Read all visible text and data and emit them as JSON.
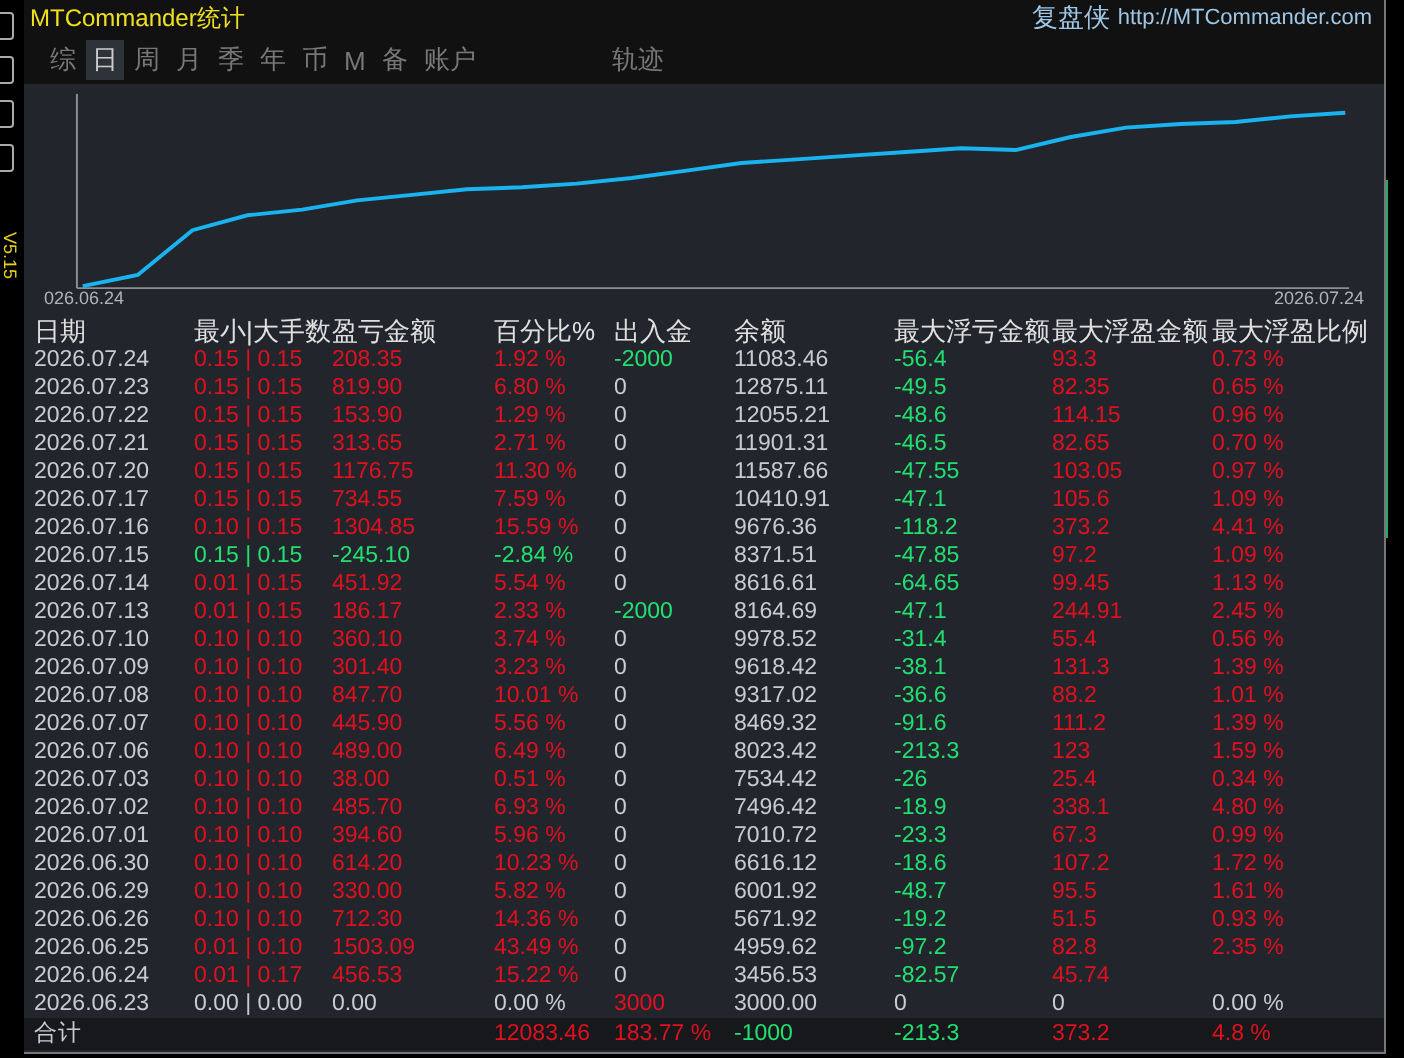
{
  "window": {
    "title": "MTCommander统计",
    "brand": "复盘侠",
    "url": "http://MTCommander.com"
  },
  "sidebar": {
    "version": "V5.15"
  },
  "tabs": [
    {
      "label": "综",
      "selected": false
    },
    {
      "label": "日",
      "selected": true
    },
    {
      "label": "周",
      "selected": false
    },
    {
      "label": "月",
      "selected": false
    },
    {
      "label": "季",
      "selected": false
    },
    {
      "label": "年",
      "selected": false
    },
    {
      "label": "币",
      "selected": false
    },
    {
      "label": "M",
      "selected": false
    },
    {
      "label": "备",
      "selected": false
    },
    {
      "label": "账户",
      "selected": false
    },
    {
      "label": "轨迹",
      "selected": false
    }
  ],
  "chart": {
    "x_start": "026.06.24",
    "x_end": "2026.07.24"
  },
  "table": {
    "columns": [
      "日期",
      "最小|大手数",
      "盈亏金额",
      "百分比%",
      "出入金",
      "余额",
      "最大浮亏金额",
      "最大浮盈金额",
      "最大浮盈比例"
    ],
    "rows": [
      {
        "kind": "profit",
        "withdrawal": true,
        "cells": [
          "2026.07.24",
          "0.15 | 0.15",
          "208.35",
          "1.92 %",
          "-2000",
          "11083.46",
          "-56.4",
          "93.3",
          "0.73 %"
        ]
      },
      {
        "kind": "profit",
        "withdrawal": false,
        "deposit": false,
        "cells": [
          "2026.07.23",
          "0.15 | 0.15",
          "819.90",
          "6.80 %",
          "0",
          "12875.11",
          "-49.5",
          "82.35",
          "0.65 %"
        ]
      },
      {
        "kind": "profit",
        "withdrawal": false,
        "deposit": false,
        "cells": [
          "2026.07.22",
          "0.15 | 0.15",
          "153.90",
          "1.29 %",
          "0",
          "12055.21",
          "-48.6",
          "114.15",
          "0.96 %"
        ]
      },
      {
        "kind": "profit",
        "withdrawal": false,
        "deposit": false,
        "cells": [
          "2026.07.21",
          "0.15 | 0.15",
          "313.65",
          "2.71 %",
          "0",
          "11901.31",
          "-46.5",
          "82.65",
          "0.70 %"
        ]
      },
      {
        "kind": "profit",
        "withdrawal": false,
        "deposit": false,
        "cells": [
          "2026.07.20",
          "0.15 | 0.15",
          "1176.75",
          "11.30 %",
          "0",
          "11587.66",
          "-47.55",
          "103.05",
          "0.97 %"
        ]
      },
      {
        "kind": "profit",
        "withdrawal": false,
        "deposit": false,
        "cells": [
          "2026.07.17",
          "0.15 | 0.15",
          "734.55",
          "7.59 %",
          "0",
          "10410.91",
          "-47.1",
          "105.6",
          "1.09 %"
        ]
      },
      {
        "kind": "profit",
        "withdrawal": false,
        "deposit": false,
        "cells": [
          "2026.07.16",
          "0.10 | 0.15",
          "1304.85",
          "15.59 %",
          "0",
          "9676.36",
          "-118.2",
          "373.2",
          "4.41 %"
        ]
      },
      {
        "kind": "loss",
        "withdrawal": false,
        "deposit": false,
        "cells": [
          "2026.07.15",
          "0.15 | 0.15",
          "-245.10",
          "-2.84 %",
          "0",
          "8371.51",
          "-47.85",
          "97.2",
          "1.09 %"
        ]
      },
      {
        "kind": "profit",
        "withdrawal": false,
        "deposit": false,
        "cells": [
          "2026.07.14",
          "0.01 | 0.15",
          "451.92",
          "5.54 %",
          "0",
          "8616.61",
          "-64.65",
          "99.45",
          "1.13 %"
        ]
      },
      {
        "kind": "profit",
        "withdrawal": true,
        "cells": [
          "2026.07.13",
          "0.01 | 0.15",
          "186.17",
          "2.33 %",
          "-2000",
          "8164.69",
          "-47.1",
          "244.91",
          "2.45 %"
        ]
      },
      {
        "kind": "profit",
        "withdrawal": false,
        "deposit": false,
        "cells": [
          "2026.07.10",
          "0.10 | 0.10",
          "360.10",
          "3.74 %",
          "0",
          "9978.52",
          "-31.4",
          "55.4",
          "0.56 %"
        ]
      },
      {
        "kind": "profit",
        "withdrawal": false,
        "deposit": false,
        "cells": [
          "2026.07.09",
          "0.10 | 0.10",
          "301.40",
          "3.23 %",
          "0",
          "9618.42",
          "-38.1",
          "131.3",
          "1.39 %"
        ]
      },
      {
        "kind": "profit",
        "withdrawal": false,
        "deposit": false,
        "cells": [
          "2026.07.08",
          "0.10 | 0.10",
          "847.70",
          "10.01 %",
          "0",
          "9317.02",
          "-36.6",
          "88.2",
          "1.01 %"
        ]
      },
      {
        "kind": "profit",
        "withdrawal": false,
        "deposit": false,
        "cells": [
          "2026.07.07",
          "0.10 | 0.10",
          "445.90",
          "5.56 %",
          "0",
          "8469.32",
          "-91.6",
          "111.2",
          "1.39 %"
        ]
      },
      {
        "kind": "profit",
        "withdrawal": false,
        "deposit": false,
        "cells": [
          "2026.07.06",
          "0.10 | 0.10",
          "489.00",
          "6.49 %",
          "0",
          "8023.42",
          "-213.3",
          "123",
          "1.59 %"
        ]
      },
      {
        "kind": "profit",
        "withdrawal": false,
        "deposit": false,
        "cells": [
          "2026.07.03",
          "0.10 | 0.10",
          "38.00",
          "0.51 %",
          "0",
          "7534.42",
          "-26",
          "25.4",
          "0.34 %"
        ]
      },
      {
        "kind": "profit",
        "withdrawal": false,
        "deposit": false,
        "cells": [
          "2026.07.02",
          "0.10 | 0.10",
          "485.70",
          "6.93 %",
          "0",
          "7496.42",
          "-18.9",
          "338.1",
          "4.80 %"
        ]
      },
      {
        "kind": "profit",
        "withdrawal": false,
        "deposit": false,
        "cells": [
          "2026.07.01",
          "0.10 | 0.10",
          "394.60",
          "5.96 %",
          "0",
          "7010.72",
          "-23.3",
          "67.3",
          "0.99 %"
        ]
      },
      {
        "kind": "profit",
        "withdrawal": false,
        "deposit": false,
        "cells": [
          "2026.06.30",
          "0.10 | 0.10",
          "614.20",
          "10.23 %",
          "0",
          "6616.12",
          "-18.6",
          "107.2",
          "1.72 %"
        ]
      },
      {
        "kind": "profit",
        "withdrawal": false,
        "deposit": false,
        "cells": [
          "2026.06.29",
          "0.10 | 0.10",
          "330.00",
          "5.82 %",
          "0",
          "6001.92",
          "-48.7",
          "95.5",
          "1.61 %"
        ]
      },
      {
        "kind": "profit",
        "withdrawal": false,
        "deposit": false,
        "cells": [
          "2026.06.26",
          "0.10 | 0.10",
          "712.30",
          "14.36 %",
          "0",
          "5671.92",
          "-19.2",
          "51.5",
          "0.93 %"
        ]
      },
      {
        "kind": "profit",
        "withdrawal": false,
        "deposit": false,
        "cells": [
          "2026.06.25",
          "0.01 | 0.10",
          "1503.09",
          "43.49 %",
          "0",
          "4959.62",
          "-97.2",
          "82.8",
          "2.35 %"
        ]
      },
      {
        "kind": "profit",
        "withdrawal": false,
        "deposit": false,
        "cells": [
          "2026.06.24",
          "0.01 | 0.17",
          "456.53",
          "15.22 %",
          "0",
          "3456.53",
          "-82.57",
          "45.74"
        ]
      },
      {
        "kind": "flat",
        "deposit": true,
        "cells": [
          "2026.06.23",
          "0.00 | 0.00",
          "0.00",
          "0.00 %",
          "3000",
          "3000.00",
          "0",
          "0",
          "0.00 %"
        ]
      }
    ],
    "total": {
      "kind": "profit",
      "withdrawal": true,
      "label": "合计",
      "cells": [
        "12083.46",
        "183.77 %",
        "-1000",
        "-213.3",
        "373.2",
        "4.8 %"
      ]
    }
  }
}
